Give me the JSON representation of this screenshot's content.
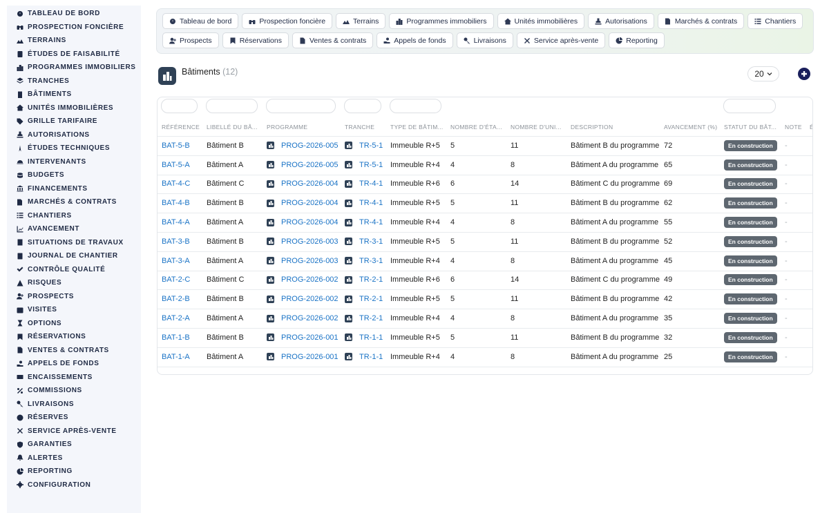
{
  "sidebar": {
    "items": [
      {
        "label": "TABLEAU DE BORD",
        "icon": "dashboard-icon"
      },
      {
        "label": "PROSPECTION FONCIÈRE",
        "icon": "binoculars-icon"
      },
      {
        "label": "TERRAINS",
        "icon": "land-icon"
      },
      {
        "label": "ÉTUDES DE FAISABILITÉ",
        "icon": "clipboard-icon"
      },
      {
        "label": "PROGRAMMES IMMOBILIERS",
        "icon": "city-icon"
      },
      {
        "label": "TRANCHES",
        "icon": "layers-icon"
      },
      {
        "label": "BÂTIMENTS",
        "icon": "building-icon"
      },
      {
        "label": "UNITÉS IMMOBILIÈRES",
        "icon": "house-icon"
      },
      {
        "label": "GRILLE TARIFAIRE",
        "icon": "tag-icon"
      },
      {
        "label": "AUTORISATIONS",
        "icon": "stamp-icon"
      },
      {
        "label": "ÉTUDES TECHNIQUES",
        "icon": "compass-icon"
      },
      {
        "label": "INTERVENANTS",
        "icon": "helmet-icon"
      },
      {
        "label": "BUDGETS",
        "icon": "coins-icon"
      },
      {
        "label": "FINANCEMENTS",
        "icon": "bank-icon"
      },
      {
        "label": "MARCHÉS & CONTRATS",
        "icon": "contract-icon"
      },
      {
        "label": "CHANTIERS",
        "icon": "list-icon"
      },
      {
        "label": "AVANCEMENT",
        "icon": "chart-line-icon"
      },
      {
        "label": "SITUATIONS DE TRAVAUX",
        "icon": "invoice-icon"
      },
      {
        "label": "JOURNAL DE CHANTIER",
        "icon": "book-icon"
      },
      {
        "label": "CONTRÔLE QUALITÉ",
        "icon": "check-icon"
      },
      {
        "label": "RISQUES",
        "icon": "warning-icon"
      },
      {
        "label": "PROSPECTS",
        "icon": "user-plus-icon"
      },
      {
        "label": "VISITES",
        "icon": "calendar-icon"
      },
      {
        "label": "OPTIONS",
        "icon": "hourglass-icon"
      },
      {
        "label": "RÉSERVATIONS",
        "icon": "bookmark-icon"
      },
      {
        "label": "VENTES & CONTRATS",
        "icon": "file-icon"
      },
      {
        "label": "APPELS DE FONDS",
        "icon": "hand-coin-icon"
      },
      {
        "label": "ENCAISSEMENTS",
        "icon": "money-icon"
      },
      {
        "label": "COMMISSIONS",
        "icon": "percent-icon"
      },
      {
        "label": "LIVRAISONS",
        "icon": "key-icon"
      },
      {
        "label": "RÉSERVES",
        "icon": "exclamation-icon"
      },
      {
        "label": "SERVICE APRÈS-VENTE",
        "icon": "tools-icon"
      },
      {
        "label": "GARANTIES",
        "icon": "shield-icon"
      },
      {
        "label": "ALERTES",
        "icon": "bell-icon"
      },
      {
        "label": "REPORTING",
        "icon": "pie-icon"
      },
      {
        "label": "CONFIGURATION",
        "icon": "gear-icon"
      }
    ]
  },
  "topnav": {
    "row1": [
      {
        "label": "Tableau de bord",
        "icon": "dashboard-icon"
      },
      {
        "label": "Prospection foncière",
        "icon": "binoculars-icon"
      },
      {
        "label": "Terrains",
        "icon": "land-icon"
      },
      {
        "label": "Programmes immobiliers",
        "icon": "city-icon"
      },
      {
        "label": "Unités immobilières",
        "icon": "house-icon"
      },
      {
        "label": "Autorisations",
        "icon": "stamp-icon"
      },
      {
        "label": "Marchés & contrats",
        "icon": "contract-icon"
      },
      {
        "label": "Chantiers",
        "icon": "list-icon"
      }
    ],
    "row2": [
      {
        "label": "Prospects",
        "icon": "user-plus-icon"
      },
      {
        "label": "Réservations",
        "icon": "bookmark-icon"
      },
      {
        "label": "Ventes & contrats",
        "icon": "file-icon"
      },
      {
        "label": "Appels de fonds",
        "icon": "hand-coin-icon"
      },
      {
        "label": "Livraisons",
        "icon": "key-icon"
      },
      {
        "label": "Service après-vente",
        "icon": "tools-icon"
      },
      {
        "label": "Reporting",
        "icon": "pie-icon"
      }
    ]
  },
  "page": {
    "title": "Bâtiments",
    "count": "(12)",
    "page_size": "20",
    "logo_icon": "building-icon",
    "add_icon": "plus-icon"
  },
  "table": {
    "headers": [
      "RÉFÉRENCE",
      "LIBELLÉ DU BÂ...",
      "PROGRAMME",
      "TRANCHE",
      "TYPE DE BÂTIM...",
      "NOMBRE D'ÉTA...",
      "NOMBRE D'UNI...",
      "DESCRIPTION",
      "AVANCEMENT (%)",
      "STATUT DU BÂT...",
      "NOTE",
      "É"
    ],
    "rows": [
      {
        "ref": "BAT-5-B",
        "libelle": "Bâtiment B",
        "programme": "PROG-2026-005",
        "tranche": "TR-5-1",
        "type": "Immeuble R+5",
        "etages": "5",
        "unites": "11",
        "description": "Bâtiment B du programme",
        "avancement": "72",
        "statut": "En construction",
        "note": "-"
      },
      {
        "ref": "BAT-5-A",
        "libelle": "Bâtiment A",
        "programme": "PROG-2026-005",
        "tranche": "TR-5-1",
        "type": "Immeuble R+4",
        "etages": "4",
        "unites": "8",
        "description": "Bâtiment A du programme",
        "avancement": "65",
        "statut": "En construction",
        "note": "-"
      },
      {
        "ref": "BAT-4-C",
        "libelle": "Bâtiment C",
        "programme": "PROG-2026-004",
        "tranche": "TR-4-1",
        "type": "Immeuble R+6",
        "etages": "6",
        "unites": "14",
        "description": "Bâtiment C du programme",
        "avancement": "69",
        "statut": "En construction",
        "note": "-"
      },
      {
        "ref": "BAT-4-B",
        "libelle": "Bâtiment B",
        "programme": "PROG-2026-004",
        "tranche": "TR-4-1",
        "type": "Immeuble R+5",
        "etages": "5",
        "unites": "11",
        "description": "Bâtiment B du programme",
        "avancement": "62",
        "statut": "En construction",
        "note": "-"
      },
      {
        "ref": "BAT-4-A",
        "libelle": "Bâtiment A",
        "programme": "PROG-2026-004",
        "tranche": "TR-4-1",
        "type": "Immeuble R+4",
        "etages": "4",
        "unites": "8",
        "description": "Bâtiment A du programme",
        "avancement": "55",
        "statut": "En construction",
        "note": "-"
      },
      {
        "ref": "BAT-3-B",
        "libelle": "Bâtiment B",
        "programme": "PROG-2026-003",
        "tranche": "TR-3-1",
        "type": "Immeuble R+5",
        "etages": "5",
        "unites": "11",
        "description": "Bâtiment B du programme",
        "avancement": "52",
        "statut": "En construction",
        "note": "-"
      },
      {
        "ref": "BAT-3-A",
        "libelle": "Bâtiment A",
        "programme": "PROG-2026-003",
        "tranche": "TR-3-1",
        "type": "Immeuble R+4",
        "etages": "4",
        "unites": "8",
        "description": "Bâtiment A du programme",
        "avancement": "45",
        "statut": "En construction",
        "note": "-"
      },
      {
        "ref": "BAT-2-C",
        "libelle": "Bâtiment C",
        "programme": "PROG-2026-002",
        "tranche": "TR-2-1",
        "type": "Immeuble R+6",
        "etages": "6",
        "unites": "14",
        "description": "Bâtiment C du programme",
        "avancement": "49",
        "statut": "En construction",
        "note": "-"
      },
      {
        "ref": "BAT-2-B",
        "libelle": "Bâtiment B",
        "programme": "PROG-2026-002",
        "tranche": "TR-2-1",
        "type": "Immeuble R+5",
        "etages": "5",
        "unites": "11",
        "description": "Bâtiment B du programme",
        "avancement": "42",
        "statut": "En construction",
        "note": "-"
      },
      {
        "ref": "BAT-2-A",
        "libelle": "Bâtiment A",
        "programme": "PROG-2026-002",
        "tranche": "TR-2-1",
        "type": "Immeuble R+4",
        "etages": "4",
        "unites": "8",
        "description": "Bâtiment A du programme",
        "avancement": "35",
        "statut": "En construction",
        "note": "-"
      },
      {
        "ref": "BAT-1-B",
        "libelle": "Bâtiment B",
        "programme": "PROG-2026-001",
        "tranche": "TR-1-1",
        "type": "Immeuble R+5",
        "etages": "5",
        "unites": "11",
        "description": "Bâtiment B du programme",
        "avancement": "32",
        "statut": "En construction",
        "note": "-"
      },
      {
        "ref": "BAT-1-A",
        "libelle": "Bâtiment A",
        "programme": "PROG-2026-001",
        "tranche": "TR-1-1",
        "type": "Immeuble R+4",
        "etages": "4",
        "unites": "8",
        "description": "Bâtiment A du programme",
        "avancement": "25",
        "statut": "En construction",
        "note": "-"
      }
    ]
  },
  "colors": {
    "link": "#1a73c6",
    "badge": "#5e6770",
    "sidebar_text": "#1f2a44",
    "add_button": "#1a1f5c"
  }
}
